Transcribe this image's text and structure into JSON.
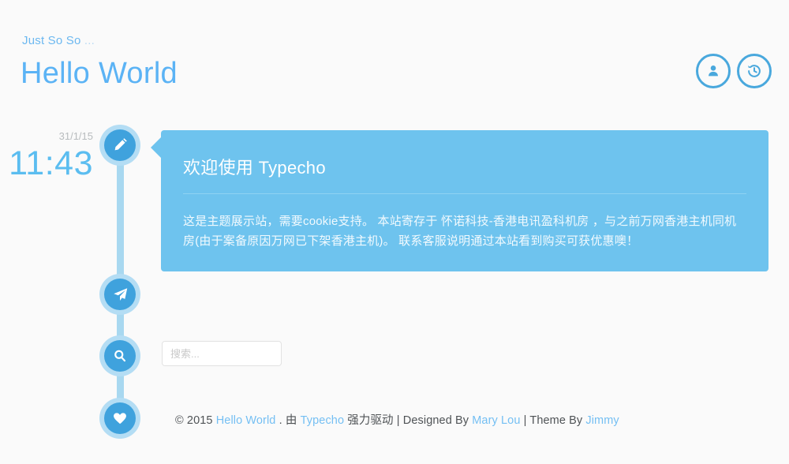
{
  "theme": {
    "background": "#fafafa",
    "accent": "#5bb3f5",
    "card_bg": "#6ec3ee",
    "node_core": "#3fa2dd",
    "node_halo": "#b4ddf4",
    "rail": "#a8d8f0",
    "link": "#74bff3",
    "muted": "#b8bcbe"
  },
  "header": {
    "tagline_text": "Just So So ",
    "tagline_dots": "...",
    "title": "Hello World",
    "actions": [
      {
        "name": "user-icon",
        "label": "User"
      },
      {
        "name": "history-icon",
        "label": "History"
      }
    ]
  },
  "timeline": {
    "nodes": [
      {
        "name": "edit-icon",
        "label": "Edit"
      },
      {
        "name": "send-icon",
        "label": "Send"
      },
      {
        "name": "search-icon",
        "label": "Search"
      },
      {
        "name": "heart-icon",
        "label": "Like"
      }
    ]
  },
  "post": {
    "date": "31/1/15",
    "time": "11:43",
    "title": "欢迎使用 Typecho",
    "body": "这是主题展示站，需要cookie支持。 本站寄存于 怀诺科技-香港电讯盈科机房 ，与之前万网香港主机同机房(由于案备原因万网已下架香港主机)。 联系客服说明通过本站看到购买可获优惠噢！"
  },
  "search": {
    "placeholder": "搜索...",
    "value": ""
  },
  "footer": {
    "copyright": "© 2015 ",
    "site_link": "Hello World",
    "dot": " . ",
    "by_word": "由 ",
    "engine_link": "Typecho",
    "powered_text": " 强力驱动 ",
    "sep1": "| ",
    "designed_by": "Designed By ",
    "designer_link": "Mary Lou",
    "sep2": " | ",
    "theme_by": "Theme By ",
    "theme_author_link": "Jimmy"
  }
}
